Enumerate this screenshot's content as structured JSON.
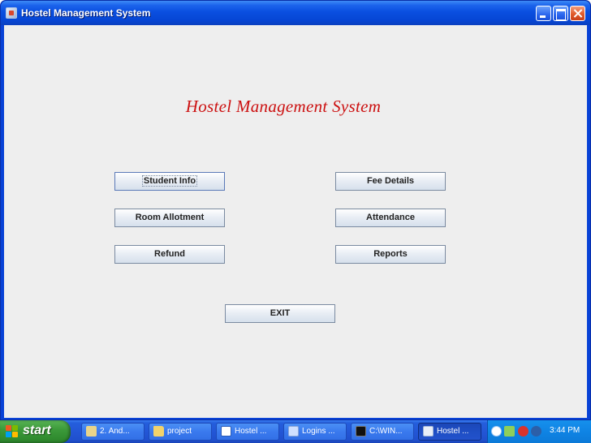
{
  "window": {
    "title": "Hostel Management System"
  },
  "main": {
    "heading": "Hostel Management System",
    "buttons": {
      "student_info": "Student Info",
      "fee_details": "Fee Details",
      "room_allotment": "Room Allotment",
      "attendance": "Attendance",
      "refund": "Refund",
      "reports": "Reports",
      "exit": "EXIT"
    }
  },
  "taskbar": {
    "start_label": "start",
    "tasks": [
      {
        "label": "2. And...",
        "icon": "pencil-icon"
      },
      {
        "label": "project",
        "icon": "folder-icon"
      },
      {
        "label": "Hostel ...",
        "icon": "word-document-icon"
      },
      {
        "label": "Logins ...",
        "icon": "document-icon"
      },
      {
        "label": "C:\\WIN...",
        "icon": "command-prompt-icon"
      },
      {
        "label": "Hostel ...",
        "icon": "java-app-icon",
        "active": true
      }
    ],
    "clock": "3:44 PM"
  },
  "colors": {
    "heading": "#cc1111",
    "client_background": "#eeeeee",
    "titlebar": "#0a4fe0",
    "start_button": "#3c9a3a"
  }
}
